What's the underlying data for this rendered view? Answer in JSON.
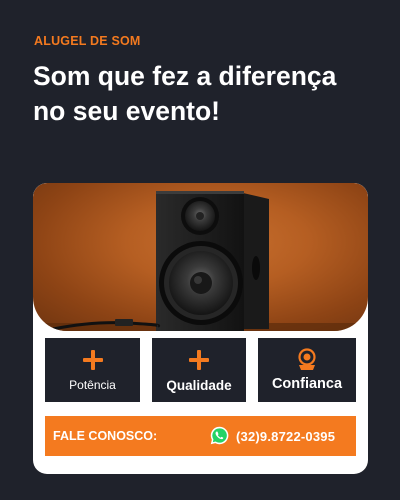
{
  "header": {
    "eyebrow": "ALUGEL DE SOM",
    "headline": "Som que fez a diferença no seu evento!"
  },
  "hero_image": {
    "alt": "speaker-photo"
  },
  "features": [
    {
      "label": "Potência",
      "icon": "plus-icon"
    },
    {
      "label": "Qualidade",
      "icon": "plus-icon"
    },
    {
      "label": "Confianca",
      "icon": "medal-icon"
    }
  ],
  "contact": {
    "label": "FALE CONOSCO:",
    "icon": "whatsapp-icon",
    "phone": "(32)9.8722-0395"
  },
  "colors": {
    "background": "#1f222b",
    "accent": "#f47a1f",
    "card": "#ffffff",
    "whatsapp": "#25d366"
  }
}
